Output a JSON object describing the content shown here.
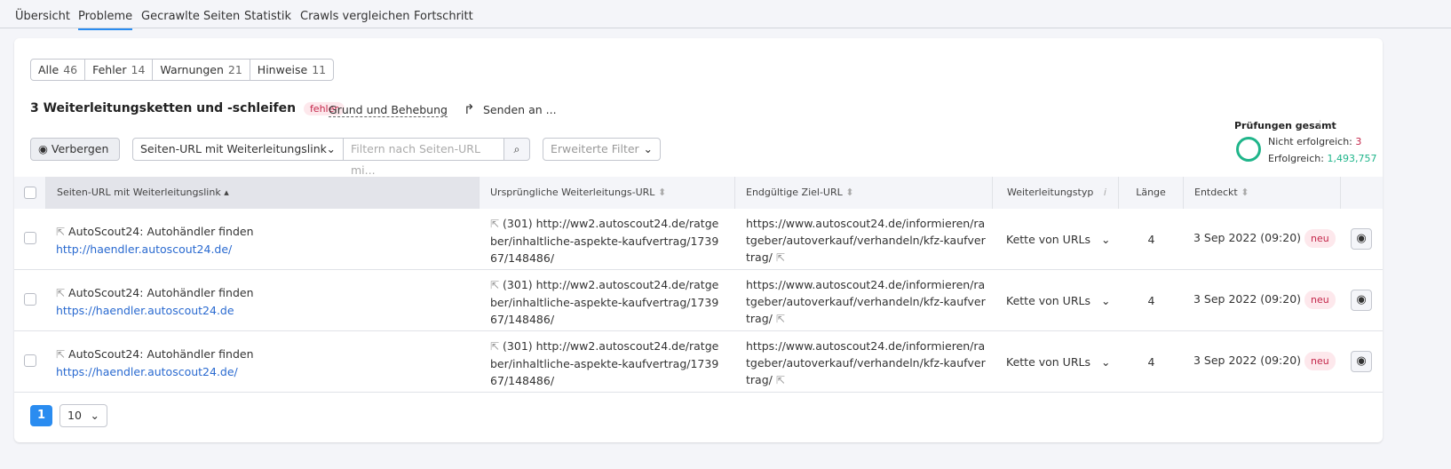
{
  "tabs": [
    "Übersicht",
    "Probleme",
    "Gecrawlte Seiten",
    "Statistik",
    "Crawls vergleichen",
    "Fortschritt"
  ],
  "segments": [
    {
      "label": "Alle",
      "count": "46"
    },
    {
      "label": "Fehler",
      "count": "14"
    },
    {
      "label": "Warnungen",
      "count": "21"
    },
    {
      "label": "Hinweise",
      "count": "11"
    }
  ],
  "issue": {
    "title": "3 Weiterleitungsketten und -schleifen",
    "badge": "fehler",
    "reason": "Grund und Behebung",
    "send": "Senden an ..."
  },
  "checks": {
    "title": "Prüfungen gesamt",
    "failed_label": "Nicht erfolgreich:",
    "failed": "3",
    "passed_label": "Erfolgreich:",
    "passed": "1,493,757"
  },
  "toolbar": {
    "hide": "Verbergen",
    "column_select": "Seiten-URL mit Weiterleitungslink",
    "filter_placeholder": "Filtern nach Seiten-URL mi...",
    "advanced": "Erweiterte Filter"
  },
  "columns": [
    "Seiten-URL mit Weiterleitungslink",
    "Ursprüngliche Weiterleitungs-URL",
    "Endgültige Ziel-URL",
    "Weiterleitungstyp",
    "Länge",
    "Entdeckt"
  ],
  "rows": [
    {
      "title": "AutoScout24: Autohändler finden",
      "url": "http://haendler.autoscout24.de/",
      "orig": "(301) http://ww2.autoscout24.de/ratgeber/inhaltliche-aspekte-kaufvertrag/173967/148486/",
      "final": "https://www.autoscout24.de/informieren/ratgeber/autoverkauf/verhandeln/kfz-kaufvertrag/",
      "type": "Kette von URLs",
      "length": "4",
      "date": "3 Sep 2022 (09:20)",
      "badge": "neu"
    },
    {
      "title": "AutoScout24: Autohändler finden",
      "url": "https://haendler.autoscout24.de",
      "orig": "(301) http://ww2.autoscout24.de/ratgeber/inhaltliche-aspekte-kaufvertrag/173967/148486/",
      "final": "https://www.autoscout24.de/informieren/ratgeber/autoverkauf/verhandeln/kfz-kaufvertrag/",
      "type": "Kette von URLs",
      "length": "4",
      "date": "3 Sep 2022 (09:20)",
      "badge": "neu"
    },
    {
      "title": "AutoScout24: Autohändler finden",
      "url": "https://haendler.autoscout24.de/",
      "orig": "(301) http://ww2.autoscout24.de/ratgeber/inhaltliche-aspekte-kaufvertrag/173967/148486/",
      "final": "https://www.autoscout24.de/informieren/ratgeber/autoverkauf/verhandeln/kfz-kaufvertrag/",
      "type": "Kette von URLs",
      "length": "4",
      "date": "3 Sep 2022 (09:20)",
      "badge": "neu"
    }
  ],
  "pagination": {
    "page": "1",
    "per_page": "10"
  },
  "colors": {
    "accent": "#2a8cf0",
    "error": "#c4264a",
    "success": "#1fb58a"
  }
}
